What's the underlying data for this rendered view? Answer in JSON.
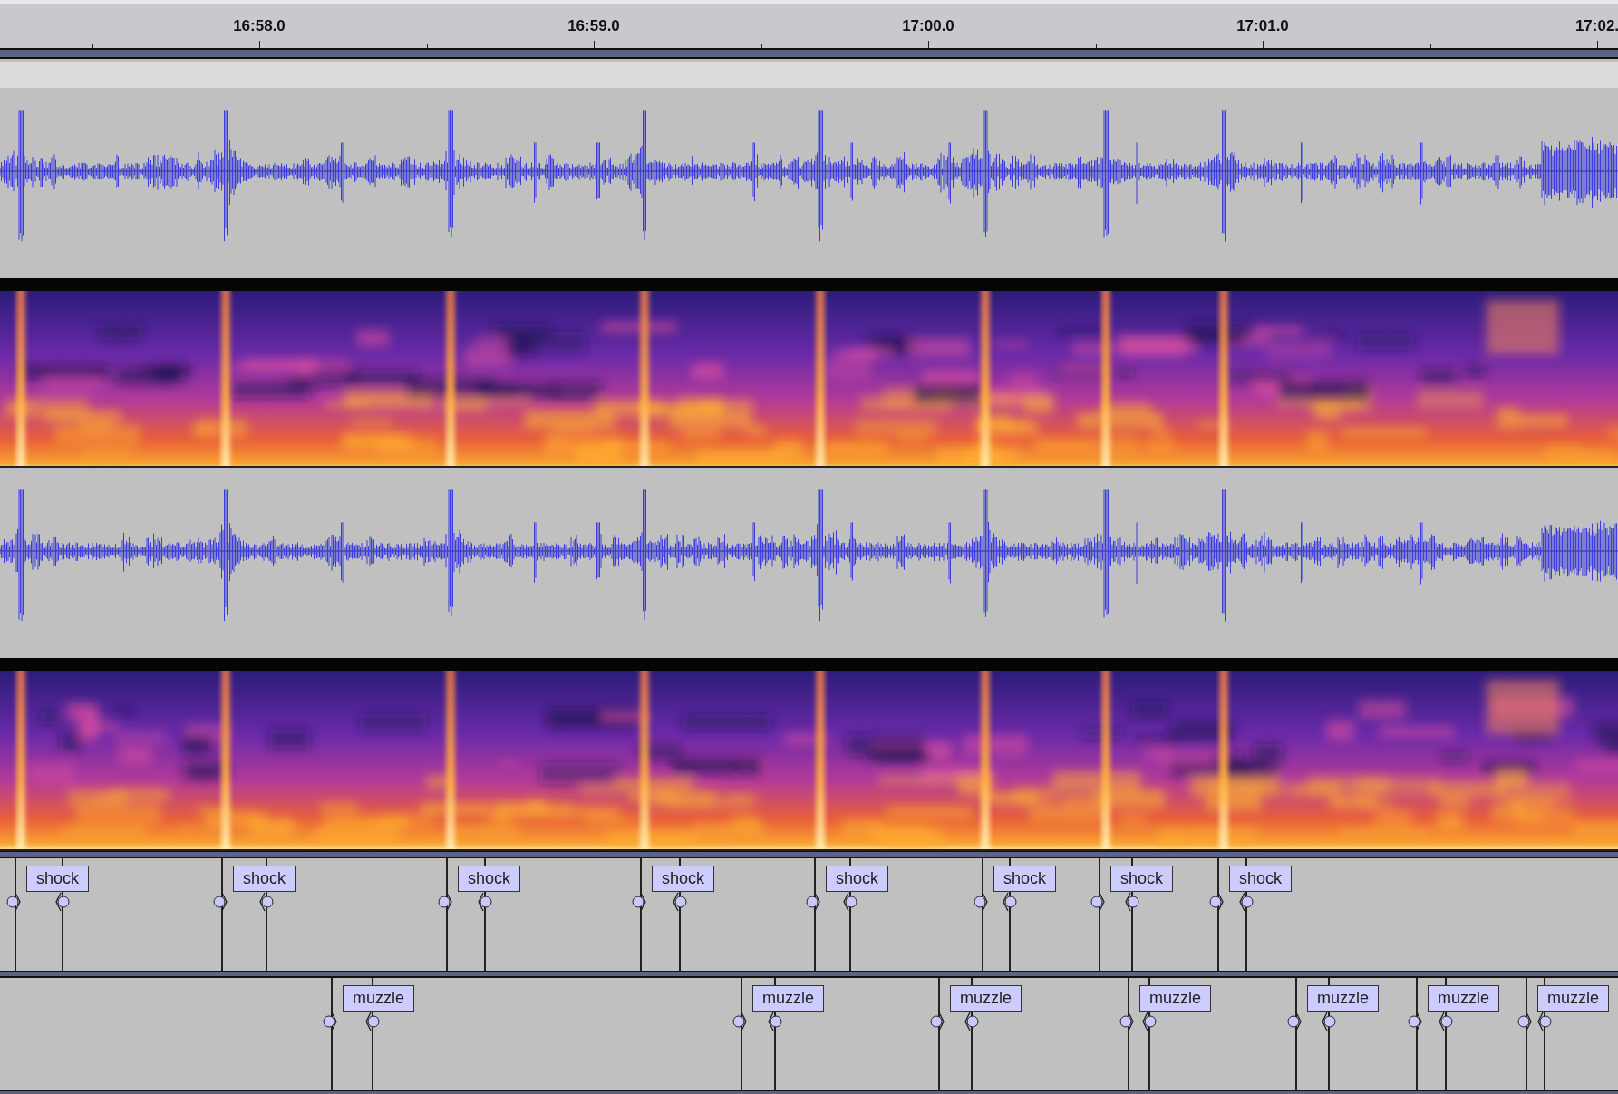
{
  "ruler": {
    "ticks": [
      {
        "label": "16:58.0"
      },
      {
        "label": "16:59.0"
      },
      {
        "label": "17:00.0"
      },
      {
        "label": "17:01.0"
      },
      {
        "label": "17:02."
      }
    ]
  },
  "tracks": [
    {
      "kind": "waveform"
    },
    {
      "kind": "spectrogram"
    },
    {
      "kind": "waveform"
    },
    {
      "kind": "spectrogram"
    },
    {
      "kind": "labels",
      "labels": [
        {
          "text": "shock"
        },
        {
          "text": "shock"
        },
        {
          "text": "shock"
        },
        {
          "text": "shock"
        },
        {
          "text": "shock"
        },
        {
          "text": "shock"
        },
        {
          "text": "shock"
        },
        {
          "text": "shock"
        }
      ]
    },
    {
      "kind": "labels",
      "labels": [
        {
          "text": "muzzle"
        },
        {
          "text": "muzzle"
        },
        {
          "text": "muzzle"
        },
        {
          "text": "muzzle"
        },
        {
          "text": "muzzle"
        },
        {
          "text": "muzzle"
        },
        {
          "text": "muzzle"
        }
      ]
    }
  ]
}
